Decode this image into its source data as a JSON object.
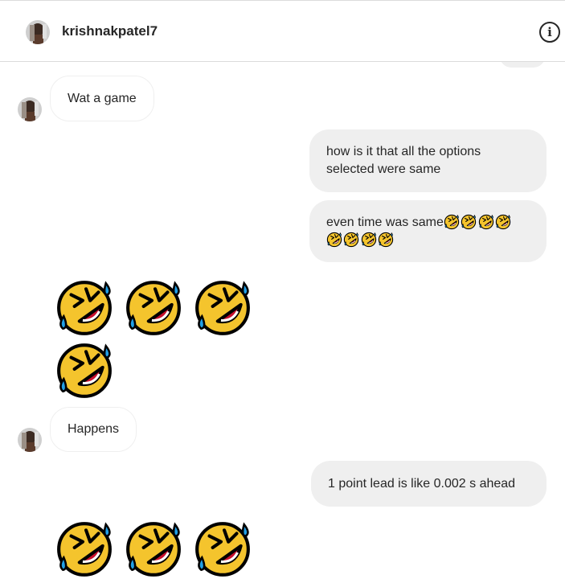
{
  "header": {
    "username": "krishnakpatel7",
    "info_icon": "info-icon",
    "info_glyph": "i"
  },
  "messages": [
    {
      "type": "received",
      "text": "Wat a game"
    },
    {
      "type": "sent",
      "text": "how is it that all the options\nselected were same"
    },
    {
      "type": "sent",
      "text": "even time was same",
      "emoji": "rolling-on-floor-laughing",
      "emoji_count": 8
    },
    {
      "type": "received-emoji",
      "emoji": "rolling-on-floor-laughing",
      "emoji_count": 4
    },
    {
      "type": "received",
      "text": "Happens"
    },
    {
      "type": "sent",
      "text": "1 point lead is like 0.002 s ahead"
    }
  ],
  "colors": {
    "bubble_sent": "#efefef",
    "bubble_received_border": "#efefef",
    "text": "#262626",
    "emoji_face": "#f4c42d",
    "emoji_tear": "#22a0e6",
    "emoji_mouth": "#c8102e"
  }
}
